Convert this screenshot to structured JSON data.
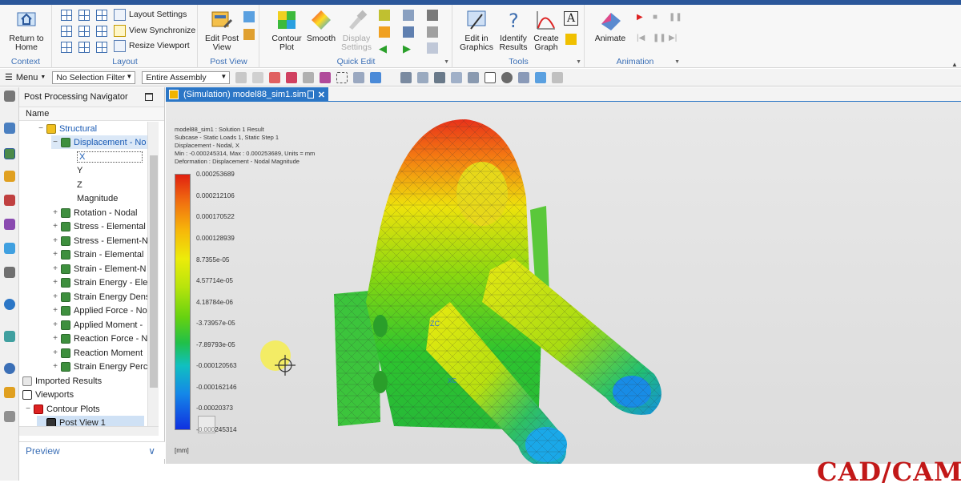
{
  "app": {
    "brand_watermark": "CAD/CAM"
  },
  "ribbon": {
    "context": {
      "label": "Context",
      "return_home": "Return to Home"
    },
    "layout": {
      "label": "Layout",
      "layout_settings": "Layout Settings",
      "view_synchronize": "View Synchronize",
      "resize_viewport": "Resize Viewport"
    },
    "post_view": {
      "label": "Post View",
      "edit_post_view": "Edit Post View"
    },
    "quick_edit": {
      "label": "Quick Edit",
      "contour_plot": "Contour Plot",
      "smooth": "Smooth",
      "display_settings": "Display Settings"
    },
    "tools": {
      "label": "Tools",
      "edit_in_graphics": "Edit in Graphics",
      "identify_results": "Identify Results",
      "create_graph": "Create Graph"
    },
    "animation": {
      "label": "Animation",
      "animate": "Animate"
    }
  },
  "toolbar": {
    "menu": "Menu",
    "selection_filter": "No Selection Filter",
    "scope": "Entire Assembly"
  },
  "navigator": {
    "title": "Post Processing Navigator",
    "column": "Name",
    "tree": [
      {
        "label": "Structural",
        "indent": 0
      },
      {
        "label": "Displacement - No",
        "indent": 1
      },
      {
        "label": "X",
        "indent": 2
      },
      {
        "label": "Y",
        "indent": 2
      },
      {
        "label": "Z",
        "indent": 2
      },
      {
        "label": "Magnitude",
        "indent": 2
      },
      {
        "label": "Rotation - Nodal",
        "indent": 1
      },
      {
        "label": "Stress - Elemental",
        "indent": 1
      },
      {
        "label": "Stress - Element-N",
        "indent": 1
      },
      {
        "label": "Strain - Elemental",
        "indent": 1
      },
      {
        "label": "Strain - Element-N",
        "indent": 1
      },
      {
        "label": "Strain Energy - Eler",
        "indent": 1
      },
      {
        "label": "Strain Energy Dens",
        "indent": 1
      },
      {
        "label": "Applied Force - No",
        "indent": 1
      },
      {
        "label": "Applied Moment -",
        "indent": 1
      },
      {
        "label": "Reaction Force - N",
        "indent": 1
      },
      {
        "label": "Reaction Moment",
        "indent": 1
      },
      {
        "label": "Strain Energy Perce",
        "indent": 1
      },
      {
        "label": "Imported Results",
        "indent": -1
      },
      {
        "label": "Viewports",
        "indent": -1
      },
      {
        "label": "Contour Plots",
        "indent": 0
      },
      {
        "label": "Post View 1",
        "indent": 1
      }
    ],
    "preview": "Preview"
  },
  "viewport": {
    "tab_title": "(Simulation) model88_sim1.sim",
    "info_lines": [
      "model88_sim1 : Solution 1 Result",
      "Subcase - Static Loads 1, Static Step 1",
      "Displacement - Nodal, X",
      "Min : -0.000245314, Max : 0.000253689, Units = mm",
      "Deformation : Displacement - Nodal Magnitude"
    ],
    "legend": [
      "0.000253689",
      "0.000212106",
      "0.000170522",
      "0.000128939",
      "8.7355e-05",
      "4.57714e-05",
      "4.18784e-06",
      "-3.73957e-05",
      "-7.89793e-05",
      "-0.000120563",
      "-0.000162146",
      "-0.00020373",
      "-0.000245314"
    ],
    "units": "[mm]",
    "triad": {
      "zc": "ZC",
      "xc": "XC"
    }
  }
}
